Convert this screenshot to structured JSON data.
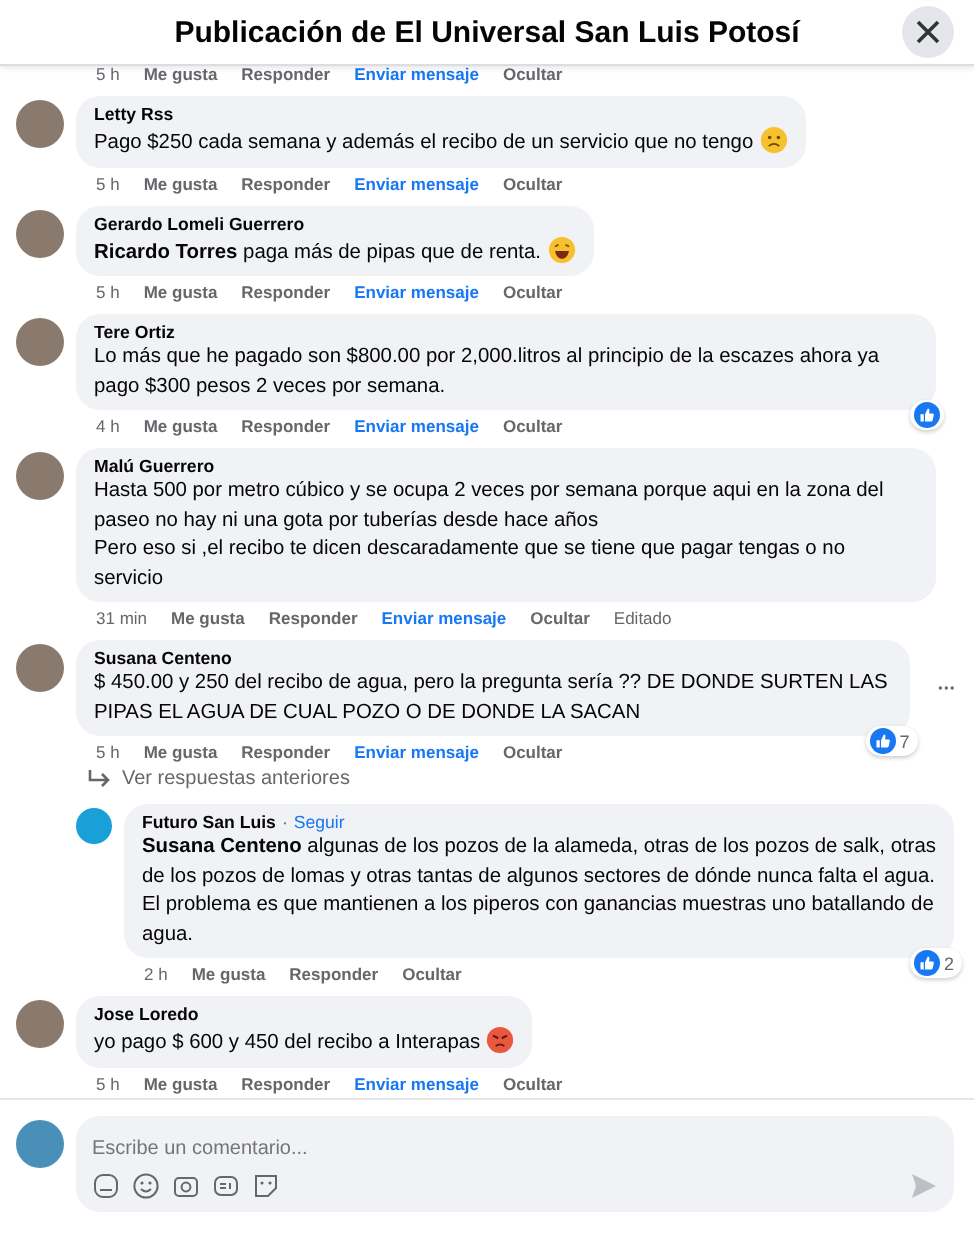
{
  "header": {
    "title": "Publicación de El Universal San Luis Potosí"
  },
  "top_actions": [
    {
      "text": "5 h",
      "kind": "time"
    },
    {
      "text": "Me gusta",
      "kind": "action"
    },
    {
      "text": "Responder",
      "kind": "action"
    },
    {
      "text": "Enviar mensaje",
      "kind": "message"
    },
    {
      "text": "Ocultar",
      "kind": "action"
    }
  ],
  "comments": [
    {
      "author": "Letty Rss",
      "reply": false,
      "text": "Pago $250 cada semana y además el recibo de un servicio que no tengo",
      "emoji": {
        "kind": "sad"
      },
      "actions": [
        {
          "text": "5 h",
          "kind": "time"
        },
        {
          "text": "Me gusta",
          "kind": "action"
        },
        {
          "text": "Responder",
          "kind": "action"
        },
        {
          "text": "Enviar mensaje",
          "kind": "message"
        },
        {
          "text": "Ocultar",
          "kind": "action"
        }
      ]
    },
    {
      "author": "Gerardo Lomeli Guerrero",
      "reply": false,
      "text": "**Ricardo Torres** paga más de pipas que de renta.",
      "emoji": {
        "kind": "laugh"
      },
      "actions": [
        {
          "text": "5 h",
          "kind": "time"
        },
        {
          "text": "Me gusta",
          "kind": "action"
        },
        {
          "text": "Responder",
          "kind": "action"
        },
        {
          "text": "Enviar mensaje",
          "kind": "message"
        },
        {
          "text": "Ocultar",
          "kind": "action"
        }
      ]
    },
    {
      "author": "Tere Ortiz",
      "reply": false,
      "text": "Lo más que he pagado son $800.00 por 2,000.litros al principio de la escazes ahora ya pago $300 pesos 2 veces por semana.",
      "reaction": {
        "kind": "like"
      },
      "actions": [
        {
          "text": "4 h",
          "kind": "time"
        },
        {
          "text": "Me gusta",
          "kind": "action"
        },
        {
          "text": "Responder",
          "kind": "action"
        },
        {
          "text": "Enviar mensaje",
          "kind": "message"
        },
        {
          "text": "Ocultar",
          "kind": "action"
        }
      ]
    },
    {
      "author": "Malú Guerrero",
      "reply": false,
      "text": "Hasta 500 por metro cúbico y se ocupa 2 veces por semana porque aqui en la zona del paseo no hay ni una gota por tuberías desde hace años\nPero eso si ,el recibo te dicen descaradamente que se tiene que pagar tengas o no servicio",
      "actions": [
        {
          "text": "31 min",
          "kind": "time"
        },
        {
          "text": "Me gusta",
          "kind": "action"
        },
        {
          "text": "Responder",
          "kind": "action"
        },
        {
          "text": "Enviar mensaje",
          "kind": "message"
        },
        {
          "text": "Ocultar",
          "kind": "action"
        },
        {
          "text": "Editado",
          "kind": "time"
        }
      ]
    },
    {
      "author": "Susana Centeno",
      "reply": false,
      "more": true,
      "text": "$ 450.00 y 250 del recibo de agua, pero la pregunta sería ?? DE DONDE SURTEN LAS PIPAS EL AGUA DE CUAL POZO O DE DONDE LA SACAN",
      "reaction": {
        "kind": "like",
        "count": "7"
      },
      "actions": [
        {
          "text": "5 h",
          "kind": "time"
        },
        {
          "text": "Me gusta",
          "kind": "action"
        },
        {
          "text": "Responder",
          "kind": "action"
        },
        {
          "text": "Enviar mensaje",
          "kind": "message"
        },
        {
          "text": "Ocultar",
          "kind": "action"
        }
      ],
      "previous_replies": "Ver respuestas anteriores"
    },
    {
      "author": "Futuro San Luis",
      "separator": "·",
      "follow": "Seguir",
      "reply": true,
      "text": "**Susana Centeno** algunas de los pozos de la alameda, otras de los pozos de salk, otras de los pozos de lomas y otras tantas de algunos sectores de dónde nunca falta el agua. El problema es que mantienen a los piperos con ganancias muestras uno batallando de agua.",
      "reaction": {
        "kind": "like",
        "count": "2"
      },
      "actions": [
        {
          "text": "2 h",
          "kind": "time"
        },
        {
          "text": "Me gusta",
          "kind": "action"
        },
        {
          "text": "Responder",
          "kind": "action"
        },
        {
          "text": "Ocultar",
          "kind": "action"
        }
      ]
    },
    {
      "author": "Jose Loredo",
      "reply": false,
      "text": "yo pago $ 600 y 450 del recibo a Interapas",
      "emoji": {
        "kind": "angry"
      },
      "actions": [
        {
          "text": "5 h",
          "kind": "time"
        },
        {
          "text": "Me gusta",
          "kind": "action"
        },
        {
          "text": "Responder",
          "kind": "action"
        },
        {
          "text": "Enviar mensaje",
          "kind": "message"
        },
        {
          "text": "Ocultar",
          "kind": "action"
        }
      ]
    }
  ],
  "composer": {
    "placeholder": "Escribe un comentario..."
  }
}
